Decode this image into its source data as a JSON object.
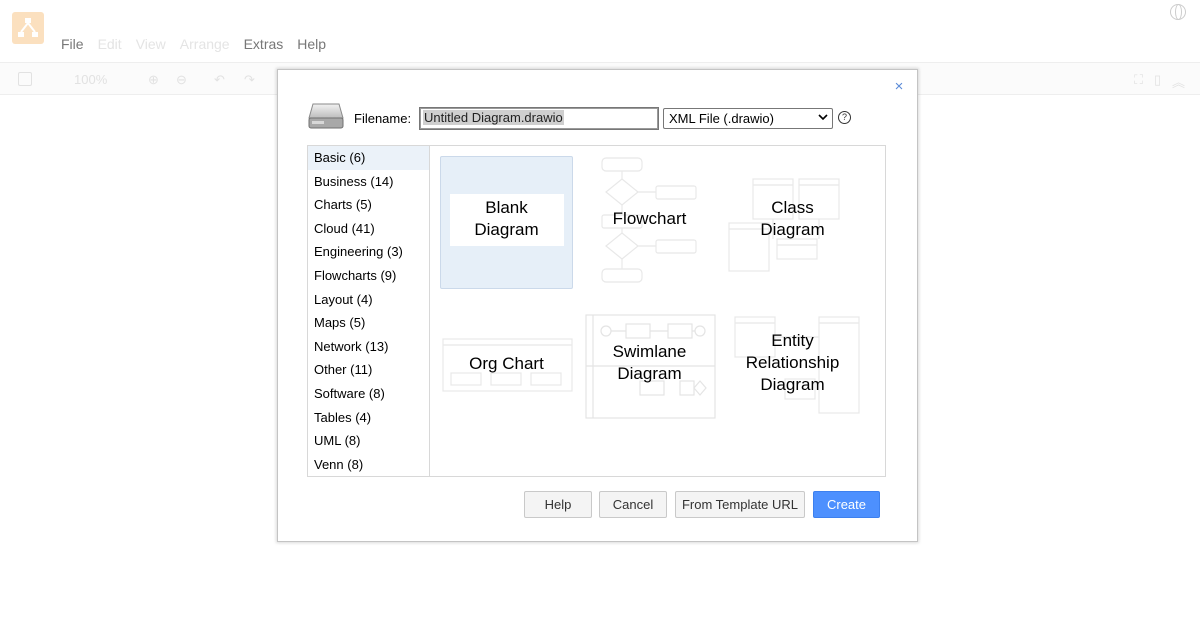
{
  "app": {
    "menu": [
      {
        "label": "File",
        "enabled": true
      },
      {
        "label": "Edit",
        "enabled": false
      },
      {
        "label": "View",
        "enabled": false
      },
      {
        "label": "Arrange",
        "enabled": false
      },
      {
        "label": "Extras",
        "enabled": true
      },
      {
        "label": "Help",
        "enabled": true
      }
    ],
    "zoom": "100%"
  },
  "dialog": {
    "filename_label": "Filename:",
    "filename_value": "Untitled Diagram.drawio",
    "format_selected": "XML File (.drawio)",
    "help_glyph": "?",
    "close_glyph": "×",
    "categories": [
      {
        "label": "Basic (6)",
        "active": true
      },
      {
        "label": "Business (14)"
      },
      {
        "label": "Charts (5)"
      },
      {
        "label": "Cloud (41)"
      },
      {
        "label": "Engineering (3)"
      },
      {
        "label": "Flowcharts (9)"
      },
      {
        "label": "Layout (4)"
      },
      {
        "label": "Maps (5)"
      },
      {
        "label": "Network (13)"
      },
      {
        "label": "Other (11)"
      },
      {
        "label": "Software (8)"
      },
      {
        "label": "Tables (4)"
      },
      {
        "label": "UML (8)"
      },
      {
        "label": "Venn (8)"
      }
    ],
    "templates": {
      "blank": [
        "Blank",
        "Diagram"
      ],
      "flowchart": [
        "Flowchart"
      ],
      "class": [
        "Class",
        "Diagram"
      ],
      "org": [
        "Org Chart"
      ],
      "swimlane": [
        "Swimlane",
        "Diagram"
      ],
      "er": [
        "Entity",
        "Relationship",
        "Diagram"
      ]
    },
    "buttons": {
      "help": "Help",
      "cancel": "Cancel",
      "from_template": "From Template URL",
      "create": "Create"
    },
    "colors": {
      "primary": "#4d90fe",
      "selected_bg": "#e6eff8",
      "close": "#5b8bd8"
    }
  }
}
